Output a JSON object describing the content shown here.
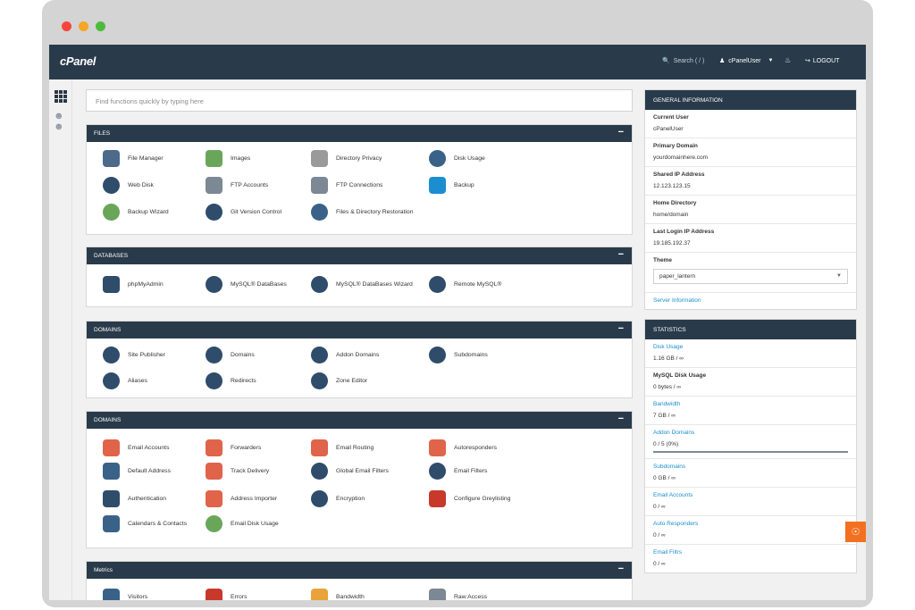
{
  "topbar": {
    "logo": "cPanel",
    "search_label": "Search ( / )",
    "user_label": "cPanelUser",
    "logout_label": "LOGOUT"
  },
  "search": {
    "placeholder": "Find functions quickly by typing here"
  },
  "panels": [
    {
      "title": "FILES",
      "items": [
        {
          "label": "File Manager",
          "icon": "file-manager-icon",
          "color": "#4e6a8a"
        },
        {
          "label": "Images",
          "icon": "images-icon",
          "color": "#6aa65a"
        },
        {
          "label": "Directory Privacy",
          "icon": "folder-icon",
          "color": "#9a9a9a"
        },
        {
          "label": "Disk Usage",
          "icon": "disk-usage-icon",
          "color": "#3a6289"
        },
        {
          "label": "Web Disk",
          "icon": "web-disk-icon",
          "color": "#2f4c6b"
        },
        {
          "label": "FTP Accounts",
          "icon": "ftp-accounts-icon",
          "color": "#7c8894"
        },
        {
          "label": "FTP Connections",
          "icon": "ftp-connections-icon",
          "color": "#7c8894"
        },
        {
          "label": "Backup",
          "icon": "backup-icon",
          "color": "#1b8ecf"
        },
        {
          "label": "Backup Wizard",
          "icon": "backup-wizard-icon",
          "color": "#6aa65a"
        },
        {
          "label": "Git Version Control",
          "icon": "git-icon",
          "color": "#2f4c6b"
        },
        {
          "label": "Files & Directory Restoration",
          "icon": "restore-icon",
          "color": "#3a6289"
        }
      ]
    },
    {
      "title": "DATABASES",
      "items": [
        {
          "label": "phpMyAdmin",
          "icon": "phpmyadmin-icon",
          "color": "#2f4c6b"
        },
        {
          "label": "MySQL® DataBases",
          "icon": "mysql-icon",
          "color": "#2f4c6b"
        },
        {
          "label": "MySQL® DataBases Wizard",
          "icon": "mysql-wizard-icon",
          "color": "#2f4c6b"
        },
        {
          "label": "Remote MySQL®",
          "icon": "remote-mysql-icon",
          "color": "#2f4c6b"
        }
      ]
    },
    {
      "title": "DOMAINS",
      "items": [
        {
          "label": "Site Publisher",
          "icon": "site-publisher-icon",
          "color": "#2f4c6b"
        },
        {
          "label": "Domains",
          "icon": "domains-icon",
          "color": "#2f4c6b"
        },
        {
          "label": "Addon Domains",
          "icon": "addon-domains-icon",
          "color": "#2f4c6b"
        },
        {
          "label": "Subdomains",
          "icon": "subdomains-icon",
          "color": "#2f4c6b"
        },
        {
          "label": "Aliases",
          "icon": "aliases-icon",
          "color": "#2f4c6b"
        },
        {
          "label": "Redirects",
          "icon": "redirects-icon",
          "color": "#2f4c6b"
        },
        {
          "label": "Zone Editor",
          "icon": "zone-editor-icon",
          "color": "#2f4c6b"
        }
      ]
    },
    {
      "title": "DOMAINS",
      "items": [
        {
          "label": "Email Accounts",
          "icon": "email-accounts-icon",
          "color": "#e0644a"
        },
        {
          "label": "Forwarders",
          "icon": "forwarders-icon",
          "color": "#e0644a"
        },
        {
          "label": "Email Routing",
          "icon": "email-routing-icon",
          "color": "#e0644a"
        },
        {
          "label": "Autoresponders",
          "icon": "autoresponders-icon",
          "color": "#e0644a"
        },
        {
          "label": "Default Address",
          "icon": "default-address-icon",
          "color": "#3a6289"
        },
        {
          "label": "Track Delivery",
          "icon": "track-delivery-icon",
          "color": "#e0644a"
        },
        {
          "label": "Global Email Filters",
          "icon": "global-filters-icon",
          "color": "#2f4c6b"
        },
        {
          "label": "Email Filters",
          "icon": "email-filters-icon",
          "color": "#2f4c6b"
        },
        {
          "label": "Authentication",
          "icon": "authentication-icon",
          "color": "#2f4c6b"
        },
        {
          "label": "Address Importer",
          "icon": "address-importer-icon",
          "color": "#e0644a"
        },
        {
          "label": "Encryption",
          "icon": "encryption-icon",
          "color": "#2f4c6b"
        },
        {
          "label": "Configure Greylisting",
          "icon": "greylisting-icon",
          "color": "#c8392b"
        },
        {
          "label": "Calendars & Contacts",
          "icon": "calendars-icon",
          "color": "#3a6289"
        },
        {
          "label": "Email Disk Usage",
          "icon": "email-disk-icon",
          "color": "#6aa65a"
        }
      ]
    },
    {
      "title": "Metrics",
      "items": [
        {
          "label": "Visitors",
          "icon": "visitors-icon",
          "color": "#3a6289"
        },
        {
          "label": "Errors",
          "icon": "errors-icon",
          "color": "#c8392b"
        },
        {
          "label": "Bandwidth",
          "icon": "bandwidth-icon",
          "color": "#e8a33a"
        },
        {
          "label": "Raw Access",
          "icon": "raw-access-icon",
          "color": "#7c8894"
        }
      ]
    }
  ],
  "general_info": {
    "title": "GENERAL INFORMATION",
    "current_user_label": "Current User",
    "current_user": "cPanelUser",
    "primary_domain_label": "Primary Domain",
    "primary_domain": "yourdomainhere.com",
    "shared_ip_label": "Shared IP Address",
    "shared_ip": "12.123.123.15",
    "home_dir_label": "Home Directory",
    "home_dir": "home/domain",
    "last_login_label": "Last Login IP Address",
    "last_login": "19.185.192.37",
    "theme_label": "Theme",
    "theme_value": "paper_lantern",
    "server_info_link": "Server Information"
  },
  "statistics": {
    "title": "STATISTICS",
    "rows": [
      {
        "label": "Disk Usage",
        "value": "1.16 GB / ∞",
        "link": true
      },
      {
        "label": "MySQL Disk Usage",
        "value": "0 bytes / ∞",
        "link": false
      },
      {
        "label": "Bandwidth",
        "value": "7 GB / ∞",
        "link": true
      },
      {
        "label": "Addon Domains",
        "value": "0 / 5 (0%)",
        "link": true,
        "progress": 0
      },
      {
        "label": "Subdomains",
        "value": "0 GB / ∞",
        "link": true
      },
      {
        "label": "Email Accounts",
        "value": "0 / ∞",
        "link": true
      },
      {
        "label": "Auto Responders",
        "value": "0 / ∞",
        "link": true
      },
      {
        "label": "Email Filtrs",
        "value": "0 / ∞",
        "link": true
      }
    ]
  },
  "colors": {
    "topbar": "#293a4a",
    "link": "#1b8ecf",
    "help_button": "#f37021"
  }
}
